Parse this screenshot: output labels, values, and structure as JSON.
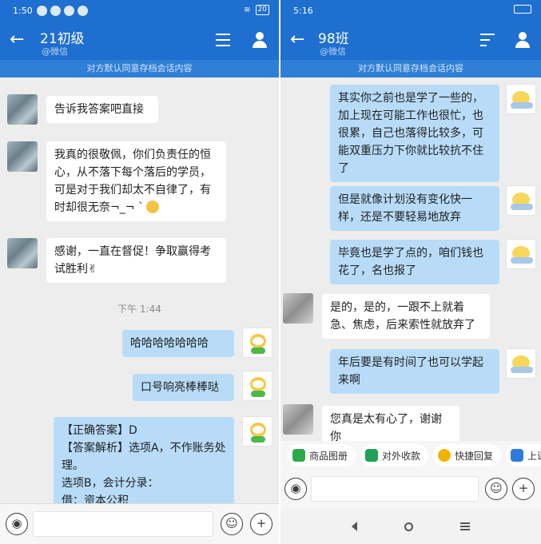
{
  "left": {
    "status": {
      "time": "1:50",
      "battery": "20"
    },
    "header": {
      "back_icon": "arrow-left-icon",
      "title": "21初级",
      "subtitle": "@微信"
    },
    "notice": "对方默认同意存档会话内容",
    "messages": [
      {
        "side": "in",
        "text": "告诉我答案吧直接"
      },
      {
        "side": "in",
        "text": "我真的很敬佩，你们负责任的恒心，从不落下每个落后的学员，可是对于我们却太不自律了，有时却很无奈¬_¬ ˋ"
      },
      {
        "side": "in",
        "text": "感谢，一直在督促！争取赢得考试胜利✌"
      },
      {
        "side": "out",
        "text": "哈哈哈哈哈哈哈"
      },
      {
        "side": "out",
        "text": "口号响亮棒棒哒"
      },
      {
        "side": "out",
        "lines": [
          "【正确答案】D",
          "【答案解析】选项A，不作账务处理。",
          "选项B，会计分录：",
          "借：资本公积"
        ]
      }
    ],
    "timestamp": "下午 1:44"
  },
  "right": {
    "status": {
      "time": "5:16"
    },
    "header": {
      "back_icon": "arrow-left-icon",
      "title": "98班",
      "subtitle": "@微信"
    },
    "notice": "对方默认同意存档会话内容",
    "messages": [
      {
        "side": "out",
        "text": "其实你之前也是学了一些的，加上现在可能工作也很忙，也很累，自己也落得比较多，可能双重压力下你就比较抗不住了"
      },
      {
        "side": "out",
        "text": "但是就像计划没有变化快一样，还是不要轻易地放弃"
      },
      {
        "side": "out",
        "text": "毕竟也是学了点的，咱们钱也花了，名也报了"
      },
      {
        "side": "in",
        "text": "是的，是的，一跟不上就着急、焦虑，后来索性就放弃了"
      },
      {
        "side": "out",
        "text": "年后要是有时间了也可以学起来啊"
      },
      {
        "side": "in",
        "text": "您真是太有心了，谢谢你"
      }
    ],
    "quick_actions": [
      "商品图册",
      "对外收款",
      "快捷回复",
      "上课"
    ],
    "colors": {
      "header": "#1e6fcf",
      "bubble_out": "#b8dcf8"
    }
  }
}
